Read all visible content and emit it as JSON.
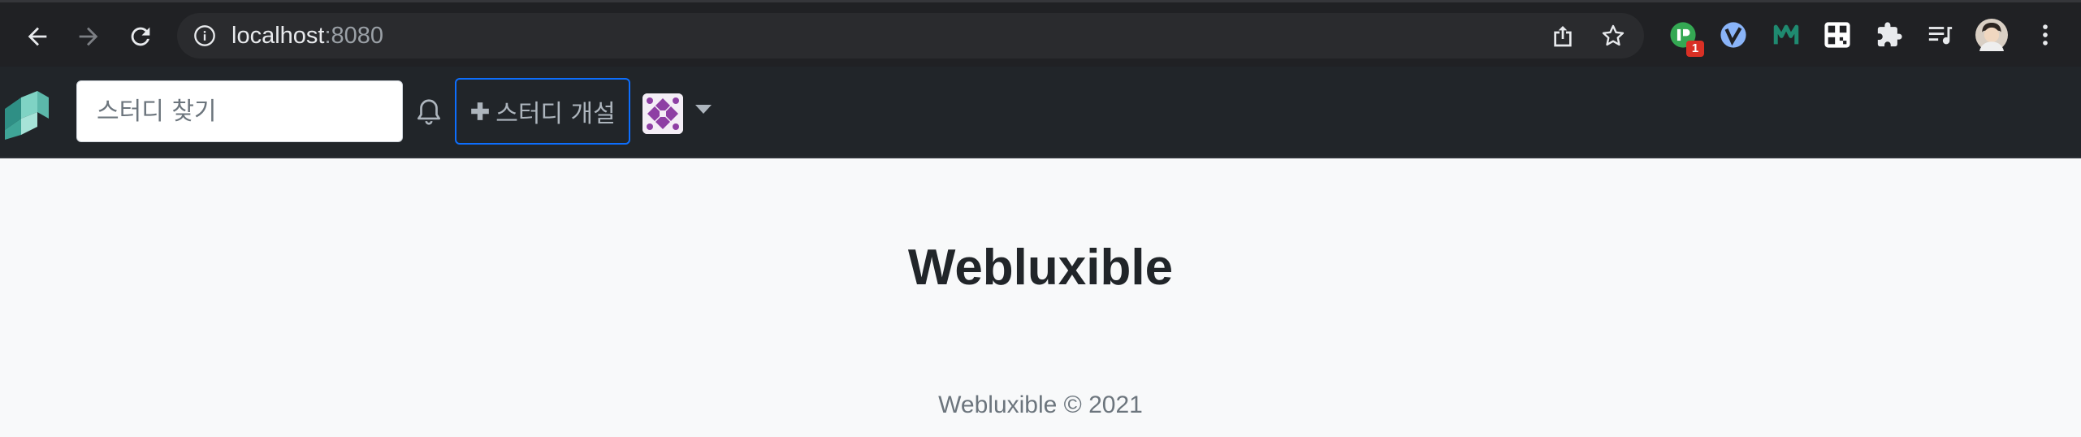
{
  "browser": {
    "url_host": "localhost",
    "url_port": ":8080",
    "extension_badge": "1"
  },
  "navbar": {
    "search_placeholder": "스터디 찾기",
    "create_study_label": "스터디 개설"
  },
  "main": {
    "title": "Webluxible"
  },
  "footer": {
    "text": "Webluxible © 2021"
  },
  "colors": {
    "navbar_bg": "#212529",
    "browser_bg": "#202124",
    "accent_border": "#0d6efd",
    "page_bg": "#f8f9fa"
  },
  "icons": [
    "back-arrow-icon",
    "forward-arrow-icon",
    "reload-icon",
    "info-icon",
    "share-icon",
    "star-icon",
    "extensions-icon",
    "reading-list-icon",
    "kebab-menu-icon",
    "bell-icon",
    "plus-icon",
    "caret-down-icon"
  ]
}
